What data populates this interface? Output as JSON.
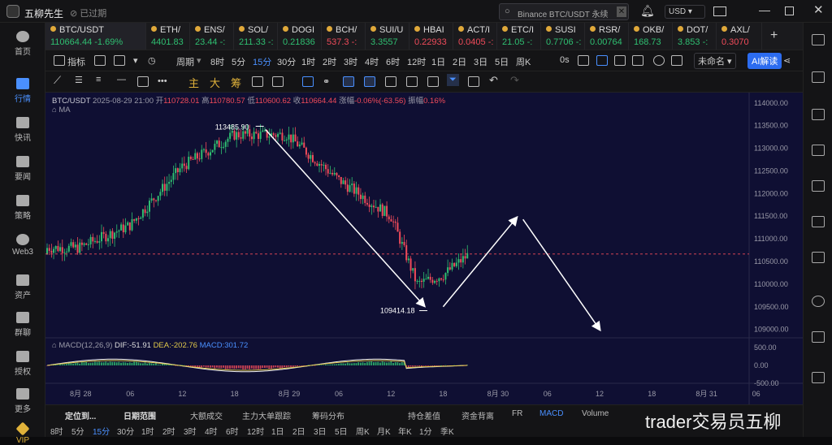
{
  "app": {
    "title": "五柳先生",
    "status": "已过期"
  },
  "search": {
    "placeholder": "Binance BTC/USDT 永续"
  },
  "currency": "USD",
  "nav": [
    {
      "label": "首页",
      "icon": "home-icon"
    },
    {
      "label": "行情",
      "icon": "market-icon"
    },
    {
      "label": "快讯",
      "icon": "flash-news-icon"
    },
    {
      "label": "要闻",
      "icon": "news-icon"
    },
    {
      "label": "策略",
      "icon": "strategy-icon"
    },
    {
      "label": "Web3",
      "icon": "web3-icon"
    },
    {
      "label": "资产",
      "icon": "wallet-icon"
    },
    {
      "label": "群聊",
      "icon": "chat-icon"
    },
    {
      "label": "授权",
      "icon": "authorize-icon"
    },
    {
      "label": "更多",
      "icon": "more-icon"
    },
    {
      "label": "VIP",
      "icon": "vip-icon"
    }
  ],
  "tickers": [
    {
      "name": "BTC/USDT",
      "price": "110664.44",
      "change": "-1.69%",
      "dir": "green"
    },
    {
      "name": "ETH/",
      "price": "4401.83",
      "change": "",
      "dir": "green"
    },
    {
      "name": "ENS/",
      "price": "23.44",
      "change": "-:",
      "dir": "green"
    },
    {
      "name": "SOL/",
      "price": "211.33",
      "change": "-:",
      "dir": "green"
    },
    {
      "name": "DOGI",
      "price": "0.21836",
      "change": "",
      "dir": "green"
    },
    {
      "name": "BCH/",
      "price": "537.3",
      "change": "-:",
      "dir": "red"
    },
    {
      "name": "SUI/U",
      "price": "3.3557",
      "change": "",
      "dir": "green"
    },
    {
      "name": "HBAI",
      "price": "0.22933",
      "change": "",
      "dir": "red"
    },
    {
      "name": "ACT/I",
      "price": "0.0405",
      "change": "-:",
      "dir": "red"
    },
    {
      "name": "ETC/I",
      "price": "21.05",
      "change": "-:",
      "dir": "green"
    },
    {
      "name": "SUSI",
      "price": "0.7706",
      "change": "-:",
      "dir": "green"
    },
    {
      "name": "RSR/",
      "price": "0.00764",
      "change": "",
      "dir": "green"
    },
    {
      "name": "OKB/",
      "price": "168.73",
      "change": "",
      "dir": "green"
    },
    {
      "name": "DOT/",
      "price": "3.853",
      "change": "-:",
      "dir": "green"
    },
    {
      "name": "AXL/",
      "price": "0.3070",
      "change": "",
      "dir": "red"
    }
  ],
  "toolbar1": {
    "indicator": "指标",
    "period": "周期",
    "intervals": [
      "8时",
      "5分",
      "15分",
      "30分",
      "1时",
      "2时",
      "3时",
      "4时",
      "6时",
      "12时",
      "1日",
      "2日",
      "3日",
      "5日",
      "周K"
    ],
    "active_interval": "15分",
    "offset": "0s",
    "layout": "未命名",
    "ai": "AI解读"
  },
  "toolbar2": {
    "draw_labels": [
      "主",
      "大",
      "筹"
    ]
  },
  "ohlc": {
    "pair": "BTC/USDT",
    "date": "2025-08-29 21:00",
    "open_label": "开",
    "open": "110728.01",
    "high_label": "高",
    "high": "110780.57",
    "low_label": "低",
    "low": "110600.62",
    "close_label": "收",
    "close": "110664.44",
    "chg_label": "涨幅",
    "chg": "-0.06%(-63.56)",
    "amp_label": "振幅",
    "amp": "0.16%",
    "ma_label": "MA"
  },
  "macd": {
    "label": "MACD(12,26,9)",
    "dif": "DIF:-51.91",
    "dea": "DEA:-202.76",
    "macd": "MACD:301.72",
    "ticks": [
      "500.00",
      "0.00",
      "-500.00"
    ]
  },
  "chart_data": {
    "type": "candlestick",
    "yticks": [
      "114000.00",
      "113500.00",
      "113000.00",
      "112500.00",
      "112000.00",
      "111500.00",
      "111000.00",
      "110500.00",
      "110000.00",
      "109500.00",
      "109000.00"
    ],
    "ylim": [
      108850,
      114050
    ],
    "xticks": [
      "8月 28",
      "06",
      "12",
      "18",
      "8月 29",
      "06",
      "12",
      "18",
      "8月 30",
      "06",
      "12",
      "18",
      "8月 31",
      "06"
    ],
    "current_price": 110664.44,
    "annotations": [
      {
        "text": "113485.90"
      },
      {
        "text": "109414.18"
      }
    ],
    "key_points": [
      {
        "x": "8月 28 00:00",
        "y": 110800
      },
      {
        "x": "8月 28 06:00",
        "y": 111300
      },
      {
        "x": "8月 28 12:00",
        "y": 112600
      },
      {
        "x": "8月 28 18:00",
        "y": 113300
      },
      {
        "x": "8月 29 00:00",
        "y": 113300
      },
      {
        "x": "8月 29 06:00",
        "y": 112300
      },
      {
        "x": "8月 29 12:00",
        "y": 111500
      },
      {
        "x": "8月 29 15:00",
        "y": 110000
      },
      {
        "x": "8月 29 18:00",
        "y": 110200
      },
      {
        "x": "8月 29 21:00",
        "y": 110664
      }
    ],
    "projection": [
      {
        "x": "8月 29 18:00",
        "y": 109500
      },
      {
        "x": "8月 30 03:00",
        "y": 111500
      },
      {
        "x": "8月 30 12:00",
        "y": 109000
      }
    ]
  },
  "bottom": {
    "tabs": [
      "定位到...",
      "日期范围",
      "大额成交",
      "主力大单跟踪",
      "筹码分布",
      "持仓差值",
      "资金背离",
      "FR",
      "MACD",
      "Volume"
    ],
    "active": "MACD",
    "intervals": [
      "8时",
      "5分",
      "15分",
      "30分",
      "1时",
      "2时",
      "3时",
      "4时",
      "6时",
      "12时",
      "1日",
      "2日",
      "3日",
      "5日",
      "周K",
      "月K",
      "年K",
      "1分",
      "季K"
    ],
    "active_interval": "15分"
  },
  "watermark": "trader交易员五柳",
  "colors": {
    "accent": "#4a90ff",
    "up": "#2fbf71",
    "down": "#f04b5a",
    "chart_bg": "#0f0f33"
  }
}
